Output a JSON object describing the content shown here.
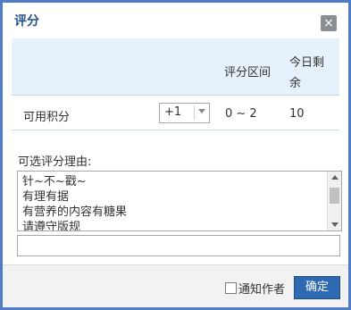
{
  "dialog": {
    "title": "评分",
    "close_glyph": "×"
  },
  "table": {
    "headers": {
      "range": "评分区间",
      "remaining_line1": "今日剩",
      "remaining_line2": "余"
    },
    "row": {
      "label": "可用积分",
      "selected_score": "+1",
      "range": "0 ~ 2",
      "remaining": "10"
    }
  },
  "reasons": {
    "label": "可选评分理由:",
    "options": [
      "针~不~戳~",
      "有理有据",
      "有营养的内容有糖果",
      "请遵守版规"
    ],
    "input_value": ""
  },
  "footer": {
    "notify_label": "通知作者",
    "notify_checked": false,
    "ok_label": "确定"
  },
  "colors": {
    "border": "#4f7cc2",
    "title": "#25518a",
    "header_band": "#e7f1fb",
    "button": "#2e6ab1"
  }
}
